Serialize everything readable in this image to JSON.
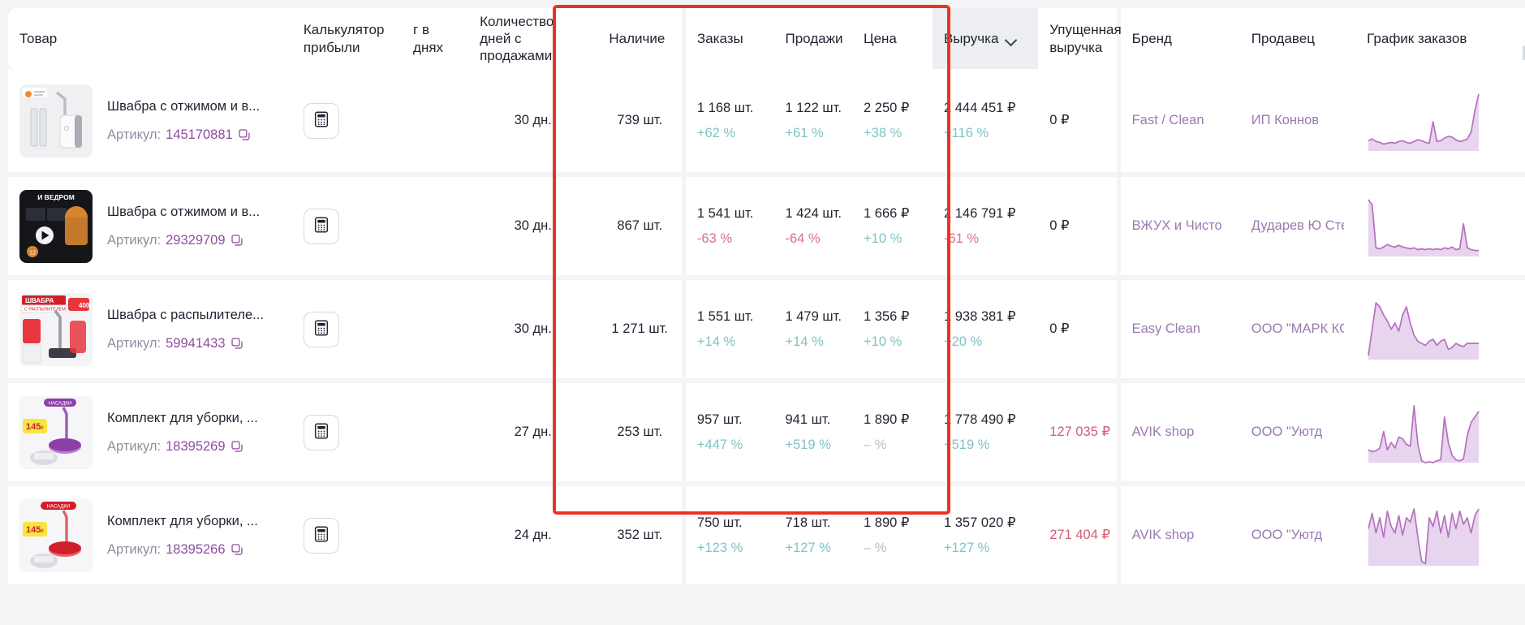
{
  "theme": {
    "accent_purple": "#8e4d9e",
    "link_purple": "#9b7ab0",
    "positive": "#7fc4c4",
    "negative": "#d9708e",
    "lost_warn": "#d35d72",
    "highlight_border": "#ee3124",
    "page_bg": "#f3f4f6",
    "sorted_header_bg": "#eceef2",
    "spark_stroke": "#b86fc0",
    "spark_fill": "#e7d4ee"
  },
  "table": {
    "columns": [
      {
        "key": "product",
        "label": "Товар",
        "align": "left"
      },
      {
        "key": "profit_calc",
        "label": "Калькулятор прибыли",
        "align": "left"
      },
      {
        "key": "turnover_days",
        "label": "г в днях",
        "align": "left"
      },
      {
        "key": "days_with_sales",
        "label": "Количество дней с продажами",
        "align": "left"
      },
      {
        "key": "stock",
        "label": "Наличие",
        "align": "left"
      },
      {
        "key": "orders",
        "label": "Заказы",
        "align": "left"
      },
      {
        "key": "sales",
        "label": "Продажи",
        "align": "left"
      },
      {
        "key": "price",
        "label": "Цена",
        "align": "left"
      },
      {
        "key": "revenue",
        "label": "Выручка",
        "align": "left",
        "sorted": true,
        "sort_icon": "chevron-down-icon"
      },
      {
        "key": "lost_revenue",
        "label": "Упущенная выручка",
        "align": "left"
      },
      {
        "key": "brand",
        "label": "Бренд",
        "align": "left"
      },
      {
        "key": "seller",
        "label": "Продавец",
        "align": "left"
      },
      {
        "key": "orders_chart",
        "label": "График заказов",
        "align": "left"
      }
    ],
    "highlighted_columns": [
      "orders",
      "sales",
      "price",
      "revenue",
      "lost_revenue"
    ],
    "rows": [
      {
        "product": {
          "title": "Швабра с отжимом и в...",
          "sku_label": "Артикул:",
          "sku": "145170881",
          "copy_icon": "copy-icon",
          "thumb": "mop-bucket-white"
        },
        "profit_calc": {
          "icon": "calculator-icon"
        },
        "turnover_days": "",
        "days_with_sales": "30 дн.",
        "stock": "739 шт.",
        "orders": {
          "value": "1 168 шт.",
          "delta": "+62 %",
          "dir": "up"
        },
        "sales": {
          "value": "1 122 шт.",
          "delta": "+61 %",
          "dir": "up"
        },
        "price": {
          "value": "2 250 ₽",
          "delta": "+38 %",
          "dir": "up"
        },
        "revenue": {
          "value": "2 444 451 ₽",
          "delta": "+116 %",
          "dir": "up"
        },
        "lost_revenue": {
          "value": "0 ₽",
          "warn": false
        },
        "brand": "Fast / Clean",
        "seller": "ИП Коннов",
        "orders_chart": [
          12,
          14,
          11,
          10,
          8,
          9,
          10,
          9,
          11,
          12,
          10,
          9,
          11,
          13,
          12,
          10,
          9,
          34,
          11,
          12,
          15,
          17,
          16,
          13,
          11,
          12,
          14,
          22,
          47,
          66
        ]
      },
      {
        "product": {
          "title": "Швабра с отжимом и в...",
          "sku_label": "Артикул:",
          "sku": "29329709",
          "copy_icon": "copy-icon",
          "thumb": "mop-bucket-dark"
        },
        "profit_calc": {
          "icon": "calculator-icon"
        },
        "turnover_days": "",
        "days_with_sales": "30 дн.",
        "stock": "867 шт.",
        "orders": {
          "value": "1 541 шт.",
          "delta": "-63 %",
          "dir": "down"
        },
        "sales": {
          "value": "1 424 шт.",
          "delta": "-64 %",
          "dir": "down"
        },
        "price": {
          "value": "1 666 ₽",
          "delta": "+10 %",
          "dir": "up"
        },
        "revenue": {
          "value": "2 146 791 ₽",
          "delta": "-61 %",
          "dir": "down"
        },
        "lost_revenue": {
          "value": "0 ₽",
          "warn": false
        },
        "brand": "ВЖУХ и Чисто",
        "seller": "Дударев Ю Степанови",
        "orders_chart": [
          66,
          60,
          10,
          9,
          11,
          14,
          12,
          11,
          13,
          11,
          10,
          9,
          10,
          8,
          9,
          8,
          9,
          8,
          9,
          8,
          10,
          9,
          11,
          8,
          9,
          38,
          10,
          8,
          7,
          7
        ]
      },
      {
        "product": {
          "title": "Швабра с распылителе...",
          "sku_label": "Артикул:",
          "sku": "59941433",
          "copy_icon": "copy-icon",
          "thumb": "mop-spray-red"
        },
        "profit_calc": {
          "icon": "calculator-icon"
        },
        "turnover_days": "",
        "days_with_sales": "30 дн.",
        "stock": "1 271 шт.",
        "orders": {
          "value": "1 551 шт.",
          "delta": "+14 %",
          "dir": "up"
        },
        "sales": {
          "value": "1 479 шт.",
          "delta": "+14 %",
          "dir": "up"
        },
        "price": {
          "value": "1 356 ₽",
          "delta": "+10 %",
          "dir": "up"
        },
        "revenue": {
          "value": "1 938 381 ₽",
          "delta": "+20 %",
          "dir": "up"
        },
        "lost_revenue": {
          "value": "0 ₽",
          "warn": false
        },
        "brand": "Easy Clean",
        "seller": "ООО \"МАРК КОНСАЛТИ",
        "orders_chart": [
          4,
          30,
          56,
          52,
          44,
          38,
          30,
          36,
          28,
          44,
          52,
          36,
          24,
          18,
          16,
          14,
          18,
          20,
          14,
          18,
          20,
          10,
          12,
          16,
          14,
          13,
          16,
          16,
          16,
          16
        ]
      },
      {
        "product": {
          "title": "Комплект для уборки, ...",
          "sku_label": "Артикул:",
          "sku": "18395269",
          "copy_icon": "copy-icon",
          "thumb": "cleaning-set-purple"
        },
        "profit_calc": {
          "icon": "calculator-icon"
        },
        "turnover_days": "",
        "days_with_sales": "27 дн.",
        "stock": "253 шт.",
        "orders": {
          "value": "957 шт.",
          "delta": "+447 %",
          "dir": "up"
        },
        "sales": {
          "value": "941 шт.",
          "delta": "+519 %",
          "dir": "up"
        },
        "price": {
          "value": "1 890 ₽",
          "delta": "– %",
          "dir": "flat"
        },
        "revenue": {
          "value": "1 778 490 ₽",
          "delta": "+519 %",
          "dir": "up"
        },
        "lost_revenue": {
          "value": "127 035 ₽",
          "warn": true
        },
        "brand": "AVIK shop",
        "seller": "ООО \"Уютд",
        "orders_chart": [
          14,
          12,
          13,
          16,
          34,
          14,
          22,
          16,
          28,
          26,
          20,
          18,
          62,
          20,
          2,
          0,
          1,
          0,
          2,
          3,
          50,
          22,
          8,
          3,
          2,
          4,
          30,
          44,
          50,
          56
        ]
      },
      {
        "product": {
          "title": "Комплект для уборки, ...",
          "sku_label": "Артикул:",
          "sku": "18395266",
          "copy_icon": "copy-icon",
          "thumb": "cleaning-set-red"
        },
        "profit_calc": {
          "icon": "calculator-icon"
        },
        "turnover_days": "",
        "days_with_sales": "24 дн.",
        "stock": "352 шт.",
        "orders": {
          "value": "750 шт.",
          "delta": "+123 %",
          "dir": "up"
        },
        "sales": {
          "value": "718 шт.",
          "delta": "+127 %",
          "dir": "up"
        },
        "price": {
          "value": "1 890 ₽",
          "delta": "– %",
          "dir": "flat"
        },
        "revenue": {
          "value": "1 357 020 ₽",
          "delta": "+127 %",
          "dir": "up"
        },
        "lost_revenue": {
          "value": "271 404 ₽",
          "warn": true
        },
        "brand": "AVIK shop",
        "seller": "ООО \"Уютд",
        "orders_chart": [
          34,
          48,
          30,
          44,
          26,
          50,
          36,
          30,
          46,
          28,
          44,
          40,
          52,
          26,
          4,
          2,
          44,
          36,
          50,
          30,
          46,
          26,
          48,
          34,
          50,
          38,
          44,
          30,
          46,
          52
        ]
      }
    ]
  },
  "chart_data": {
    "type": "line",
    "title": "График заказов",
    "xlabel": "",
    "ylabel": "Заказы",
    "grid": false,
    "legend_position": "none",
    "series": [
      {
        "name": "145170881",
        "values": [
          12,
          14,
          11,
          10,
          8,
          9,
          10,
          9,
          11,
          12,
          10,
          9,
          11,
          13,
          12,
          10,
          9,
          34,
          11,
          12,
          15,
          17,
          16,
          13,
          11,
          12,
          14,
          22,
          47,
          66
        ]
      },
      {
        "name": "29329709",
        "values": [
          66,
          60,
          10,
          9,
          11,
          14,
          12,
          11,
          13,
          11,
          10,
          9,
          10,
          8,
          9,
          8,
          9,
          8,
          9,
          8,
          10,
          9,
          11,
          8,
          9,
          38,
          10,
          8,
          7,
          7
        ]
      },
      {
        "name": "59941433",
        "values": [
          4,
          30,
          56,
          52,
          44,
          38,
          30,
          36,
          28,
          44,
          52,
          36,
          24,
          18,
          16,
          14,
          18,
          20,
          14,
          18,
          20,
          10,
          12,
          16,
          14,
          13,
          16,
          16,
          16,
          16
        ]
      },
      {
        "name": "18395269",
        "values": [
          14,
          12,
          13,
          16,
          34,
          14,
          22,
          16,
          28,
          26,
          20,
          18,
          62,
          20,
          2,
          0,
          1,
          0,
          2,
          3,
          50,
          22,
          8,
          3,
          2,
          4,
          30,
          44,
          50,
          56
        ]
      },
      {
        "name": "18395266",
        "values": [
          34,
          48,
          30,
          44,
          26,
          50,
          36,
          30,
          46,
          28,
          44,
          40,
          52,
          26,
          4,
          2,
          44,
          36,
          50,
          30,
          46,
          26,
          48,
          34,
          50,
          38,
          44,
          30,
          46,
          52
        ]
      }
    ]
  }
}
